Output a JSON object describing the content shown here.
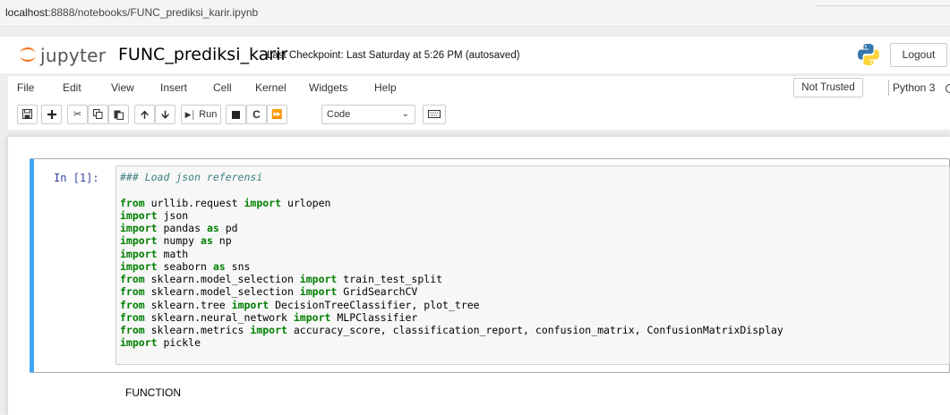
{
  "browser": {
    "url_host": "localhost",
    "url_path": ":8888/notebooks/FUNC_prediksi_karir.ipynb"
  },
  "header": {
    "logo_text": "jupyter",
    "notebook_name": "FUNC_prediksi_karir",
    "checkpoint": "Last Checkpoint: Last Saturday at 5:26 PM  (autosaved)",
    "logout": "Logout"
  },
  "menubar": {
    "items": [
      "File",
      "Edit",
      "View",
      "Insert",
      "Cell",
      "Kernel",
      "Widgets",
      "Help"
    ],
    "trust": "Not Trusted",
    "kernel": "Python 3"
  },
  "toolbar": {
    "run_label": "Run",
    "cell_type": "Code"
  },
  "cell": {
    "prompt": "In [1]:",
    "lines": [
      [
        {
          "t": "### Load json referensi",
          "c": "cm"
        }
      ],
      [
        {
          "t": "",
          "c": ""
        }
      ],
      [
        {
          "t": "from",
          "c": "kw"
        },
        {
          "t": " urllib.request ",
          "c": ""
        },
        {
          "t": "import",
          "c": "kw"
        },
        {
          "t": " urlopen",
          "c": ""
        }
      ],
      [
        {
          "t": "import",
          "c": "kw"
        },
        {
          "t": " json",
          "c": ""
        }
      ],
      [
        {
          "t": "import",
          "c": "kw"
        },
        {
          "t": " pandas ",
          "c": ""
        },
        {
          "t": "as",
          "c": "kw"
        },
        {
          "t": " pd",
          "c": ""
        }
      ],
      [
        {
          "t": "import",
          "c": "kw"
        },
        {
          "t": " numpy ",
          "c": ""
        },
        {
          "t": "as",
          "c": "kw"
        },
        {
          "t": " np",
          "c": ""
        }
      ],
      [
        {
          "t": "import",
          "c": "kw"
        },
        {
          "t": " math",
          "c": ""
        }
      ],
      [
        {
          "t": "import",
          "c": "kw"
        },
        {
          "t": " seaborn ",
          "c": ""
        },
        {
          "t": "as",
          "c": "kw"
        },
        {
          "t": " sns",
          "c": ""
        }
      ],
      [
        {
          "t": "from",
          "c": "kw"
        },
        {
          "t": " sklearn.model_selection ",
          "c": ""
        },
        {
          "t": "import",
          "c": "kw"
        },
        {
          "t": " train_test_split",
          "c": ""
        }
      ],
      [
        {
          "t": "from",
          "c": "kw"
        },
        {
          "t": " sklearn.model_selection ",
          "c": ""
        },
        {
          "t": "import",
          "c": "kw"
        },
        {
          "t": " GridSearchCV",
          "c": ""
        }
      ],
      [
        {
          "t": "from",
          "c": "kw"
        },
        {
          "t": " sklearn.tree ",
          "c": ""
        },
        {
          "t": "import",
          "c": "kw"
        },
        {
          "t": " DecisionTreeClassifier, plot_tree",
          "c": ""
        }
      ],
      [
        {
          "t": "from",
          "c": "kw"
        },
        {
          "t": " sklearn.neural_network ",
          "c": ""
        },
        {
          "t": "import",
          "c": "kw"
        },
        {
          "t": " MLPClassifier",
          "c": ""
        }
      ],
      [
        {
          "t": "from",
          "c": "kw"
        },
        {
          "t": " sklearn.metrics ",
          "c": ""
        },
        {
          "t": "import",
          "c": "kw"
        },
        {
          "t": " accuracy_score, classification_report, confusion_matrix, ConfusionMatrixDisplay",
          "c": ""
        }
      ],
      [
        {
          "t": "import",
          "c": "kw"
        },
        {
          "t": " pickle",
          "c": ""
        }
      ]
    ]
  },
  "markdown": {
    "heading": "FUNCTION"
  },
  "colors": {
    "cell_selected_border": "#42a5f5",
    "prompt": "#303f9f",
    "keyword": "#008000",
    "comment": "#408080"
  }
}
